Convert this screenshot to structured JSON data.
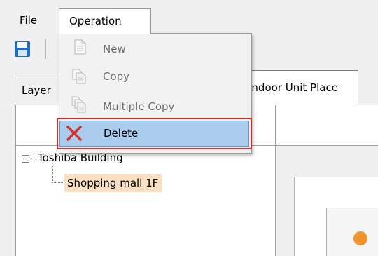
{
  "menubar": {
    "file_label": "File",
    "operation_label": "Operation"
  },
  "dropdown": {
    "items": [
      {
        "label": "New",
        "icon": "new-document-icon",
        "enabled": false
      },
      {
        "label": "Copy",
        "icon": "copy-icon",
        "enabled": false
      },
      {
        "label": "Multiple Copy",
        "icon": "multiple-copy-icon",
        "enabled": false
      },
      {
        "label": "Delete",
        "icon": "delete-x-icon",
        "enabled": true,
        "highlighted": true
      }
    ]
  },
  "tabs": {
    "layer_label": "Layer",
    "indoor_label": "Indoor Unit Place"
  },
  "tree": {
    "root_label": "Toshiba Building",
    "child_label": "Shopping mall 1F"
  },
  "colors": {
    "highlight": "#aacdee",
    "focus_border": "#c9302c",
    "selected_node": "#fce0c4",
    "unit_marker": "#f0932b"
  }
}
